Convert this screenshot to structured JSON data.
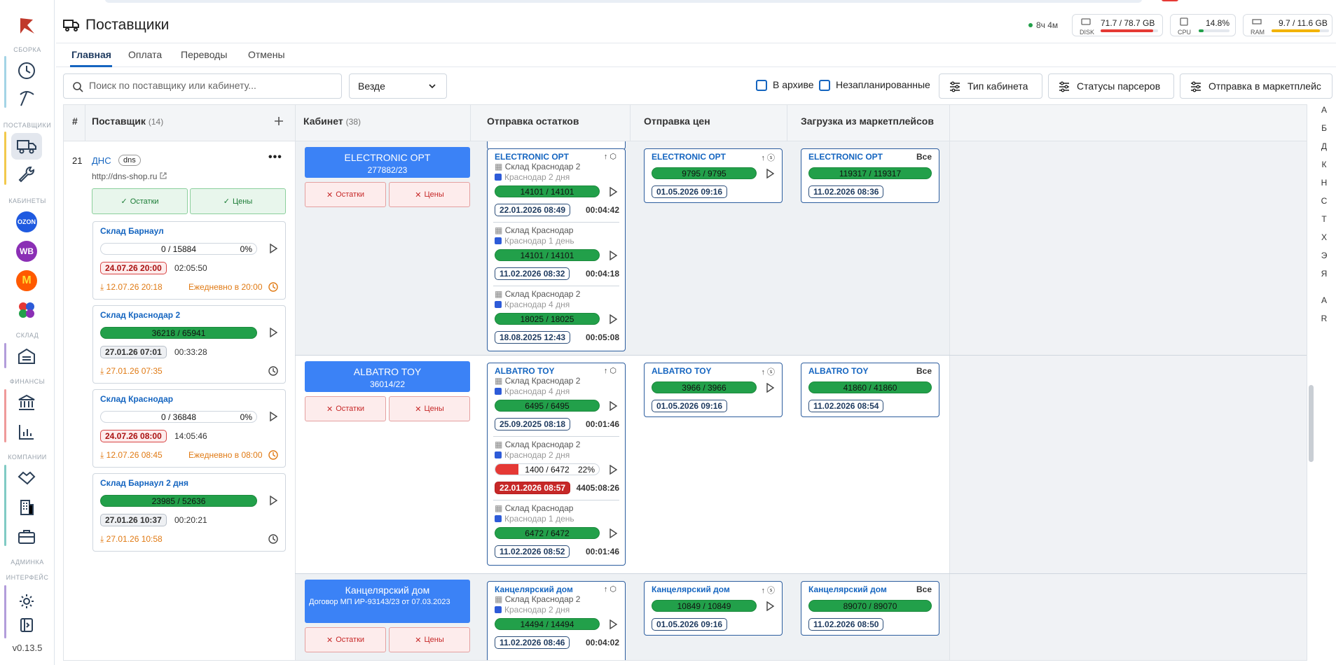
{
  "app": {
    "title": "Поставщики",
    "version": "v0.13.5",
    "uptime": "8ч 4м"
  },
  "stats": {
    "disk": {
      "label": "DISK",
      "value": "71.7 / 78.7 GB",
      "fill": 0.91,
      "color": "#e53935"
    },
    "cpu": {
      "label": "CPU",
      "value": "14.8%",
      "fill": 0.148,
      "color": "#22a04a"
    },
    "ram": {
      "label": "RAM",
      "value": "9.7 / 11.6 GB",
      "fill": 0.84,
      "color": "#f2b300"
    }
  },
  "sidebar": {
    "sections": [
      "СБОРКА",
      "ПОСТАВЩИКИ",
      "КАБИНЕТЫ",
      "СКЛАД",
      "ФИНАНСЫ",
      "КОМПАНИИ",
      "АДМИНКА",
      "ИНТЕРФЕЙС"
    ],
    "marketplaces": {
      "ozon": "OZON",
      "wb": "WB",
      "ym": "М"
    }
  },
  "tabs": [
    "Главная",
    "Оплата",
    "Переводы",
    "Отмены"
  ],
  "filters": {
    "search_placeholder": "Поиск по поставщику или кабинету...",
    "location": "Везде",
    "archive": "В архиве",
    "unplanned": "Незапланированные",
    "cabinet_type": "Тип кабинета",
    "parser_status": "Статусы парсеров",
    "send_marketplace": "Отправка в маркетплейс"
  },
  "grid": {
    "col_num": "#",
    "col_supplier": "Поставщик",
    "supplier_count": "(14)",
    "col_cabinet": "Кабинет",
    "cabinet_count": "(38)",
    "col_stock": "Отправка остатков",
    "col_prices": "Отправка цен",
    "col_load": "Загрузка из маркетплейсов"
  },
  "supplier": {
    "num": "21",
    "name": "ДНС",
    "tag": "dns",
    "url": "http://dns-shop.ru",
    "btn_stock": "Остатки",
    "btn_prices": "Цены",
    "skus": [
      {
        "name": "Склад Барнаул",
        "progress": "0 / 15884",
        "pct": "0%",
        "date": "24.07.26 20:00",
        "dur": "02:05:50",
        "load": "12.07.26 20:18",
        "sched": "Ежедневно в 20:00"
      },
      {
        "name": "Склад Краснодар 2",
        "progress": "36218 / 65941",
        "date": "27.01.26 07:01",
        "dur": "00:33:28",
        "load": "27.01.26 07:35"
      },
      {
        "name": "Склад Краснодар",
        "progress": "0 / 36848",
        "pct": "0%",
        "date": "24.07.26 08:00",
        "dur": "14:05:46",
        "load": "12.07.26 08:45",
        "sched": "Ежедневно в 08:00"
      },
      {
        "name": "Склад Барнаул 2 дня",
        "progress": "23985 / 52636",
        "date": "27.01.26 10:37",
        "dur": "00:20:21",
        "load": "27.01.26 10:58"
      }
    ]
  },
  "cabinets": [
    {
      "name": "ELECTRONIC OPT",
      "sub": "277882/23",
      "x_stock": "Остатки",
      "x_prices": "Цены",
      "stock": [
        {
          "wh": "Склад Краснодар 2",
          "mp": "Краснодар 2 дня",
          "progress": "14101 / 14101",
          "date": "22.01.2026 08:49",
          "dur": "00:04:42"
        },
        {
          "wh": "Склад Краснодар",
          "mp": "Краснодар 1 день",
          "progress": "14101 / 14101",
          "date": "11.02.2026 08:32",
          "dur": "00:04:18"
        },
        {
          "wh": "Склад Краснодар 2",
          "mp": "Краснодар 4 дня",
          "progress": "18025 / 18025",
          "date": "18.08.2025 12:43",
          "dur": "00:05:08"
        }
      ],
      "prices": {
        "progress": "9795 / 9795",
        "date": "01.05.2026 09:16"
      },
      "load": {
        "all": "Все",
        "progress": "119317 / 119317",
        "date": "11.02.2026 08:36"
      }
    },
    {
      "name": "ALBATRO TOY",
      "sub": "36014/22",
      "x_stock": "Остатки",
      "x_prices": "Цены",
      "stock": [
        {
          "wh": "Склад Краснодар 2",
          "mp": "Краснодар 4 дня",
          "progress": "6495 / 6495",
          "date": "25.09.2025 08:18",
          "dur": "00:01:46"
        },
        {
          "wh": "Склад Краснодар 2",
          "mp": "Краснодар 2 дня",
          "progress": "1400 / 6472",
          "pct": "22%",
          "fill": 0.22,
          "date": "22.01.2026 08:57",
          "dur": "4405:08:26"
        },
        {
          "wh": "Склад Краснодар",
          "mp": "Краснодар 1 день",
          "progress": "6472 / 6472",
          "date": "11.02.2026 08:52",
          "dur": "00:01:46"
        }
      ],
      "prices": {
        "progress": "3966 / 3966",
        "date": "01.05.2026 09:16"
      },
      "load": {
        "all": "Все",
        "progress": "41860 / 41860",
        "date": "11.02.2026 08:54"
      }
    },
    {
      "name": "Канцелярский дом",
      "sub": "Договор МП ИР-93143/23 от 07.03.2023",
      "x_stock": "Остатки",
      "x_prices": "Цены",
      "stock": [
        {
          "wh": "Склад Краснодар 2",
          "mp": "Краснодар 2 дня",
          "progress": "14494 / 14494",
          "date": "11.02.2026 08:46",
          "dur": "00:04:02"
        }
      ],
      "prices": {
        "progress": "10849 / 10849",
        "date": "01.05.2026 09:16"
      },
      "load": {
        "all": "Все",
        "progress": "89070 / 89070",
        "date": "11.02.2026 08:50"
      }
    }
  ],
  "alphabet": [
    "А",
    "Б",
    "Д",
    "К",
    "Н",
    "С",
    "Т",
    "Х",
    "Э",
    "Я",
    "A",
    "R"
  ]
}
